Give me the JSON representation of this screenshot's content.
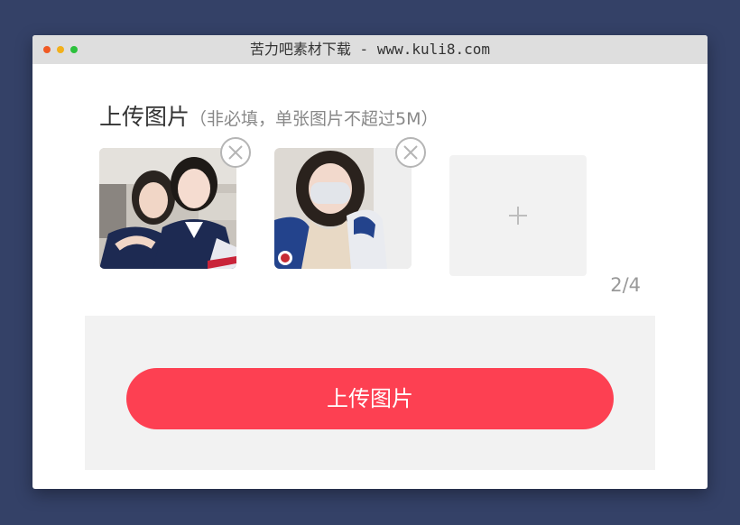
{
  "window": {
    "title": "苦力吧素材下载 - www.kuli8.com"
  },
  "upload": {
    "heading": "上传图片",
    "hint": "（非必填，单张图片不超过5M）",
    "photos": [
      {
        "name": "photo-1",
        "remove_icon": "close-circle-icon"
      },
      {
        "name": "photo-2",
        "remove_icon": "close-circle-icon"
      }
    ],
    "add_icon": "plus-icon",
    "counter": "2/4",
    "button_label": "上传图片"
  },
  "colors": {
    "page_bg": "#344167",
    "titlebar_bg": "#dedede",
    "button_bg": "#fd4052",
    "panel_bg": "#f2f2f2",
    "traffic_red": "#f05a24",
    "traffic_yellow": "#f2b01c",
    "traffic_green": "#2cc13c"
  }
}
